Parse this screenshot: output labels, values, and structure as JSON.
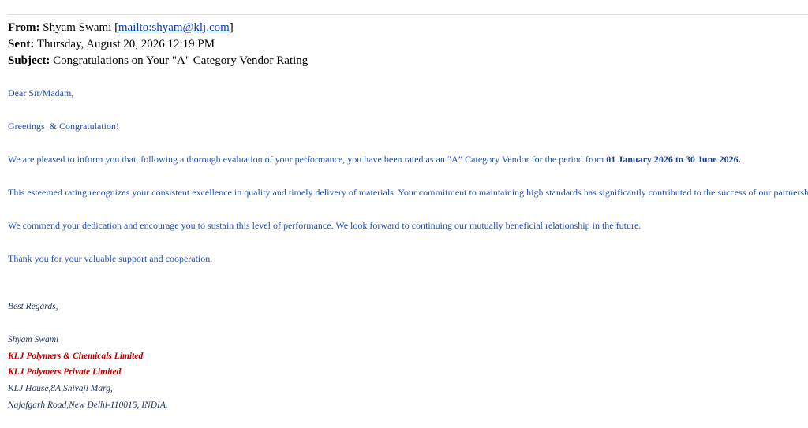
{
  "header": {
    "from_label": "From:",
    "from_name": "Shyam Swami",
    "from_bracket_open": "[",
    "from_link": "mailto:shyam@klj.com",
    "from_bracket_close": "]",
    "sent_label": "Sent:",
    "sent_value": "Thursday, August 20, 2026 12:19 PM",
    "subject_label": "Subject:",
    "subject_value": "Congratulations on Your \"A\" Category Vendor Rating"
  },
  "body": {
    "salutation": "Dear Sir/Madam,",
    "greeting": "Greetings  & Congratulation!",
    "p1_text": "We are pleased to inform you that, following a thorough evaluation of your performance, you have been rated as an “A” Category Vendor for the period from",
    "p1_period": "01 January 2026 to 30 June 2026.",
    "p2": "This esteemed rating recognizes your consistent excellence in quality and timely delivery of materials. Your commitment to maintaining high standards has significantly contributed to the success of our partnership.",
    "p3": "We commend your dedication and encourage you to sustain this level of performance. We look forward to continuing our mutually beneficial relationship in the future.",
    "p4": "Thank you for your valuable support and cooperation."
  },
  "signature": {
    "regards": "Best Regards,",
    "name": "Shyam Swami",
    "company_1": "KLJ Polymers & Chemicals Limited",
    "company_2": "KLJ Polymers Private Limited",
    "address_1": "KLJ House,8A,Shivaji Marg,",
    "address_2": "Najafgarh Road,New Delhi-110015, INDIA."
  },
  "colors": {
    "body_text": "#1f4fbf",
    "signature_text": "#1f3864",
    "company_text": "#c00000",
    "link": "#0b3bb5"
  }
}
